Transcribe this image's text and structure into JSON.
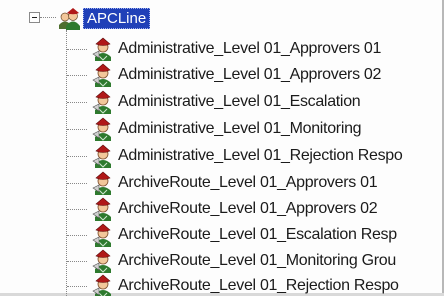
{
  "tree": {
    "root": {
      "label": "APCLine",
      "icon": "user-group-icon",
      "expanded": true,
      "selected": true
    },
    "children": [
      {
        "label": "Administrative_Level 01_Approvers 01",
        "icon": "user-role-icon"
      },
      {
        "label": "Administrative_Level 01_Approvers 02",
        "icon": "user-role-icon"
      },
      {
        "label": "Administrative_Level 01_Escalation",
        "icon": "user-role-icon"
      },
      {
        "label": "Administrative_Level 01_Monitoring",
        "icon": "user-role-icon"
      },
      {
        "label": "Administrative_Level 01_Rejection Respo",
        "icon": "user-role-icon"
      },
      {
        "label": "ArchiveRoute_Level 01_Approvers 01",
        "icon": "user-role-icon"
      },
      {
        "label": "ArchiveRoute_Level 01_Approvers 02",
        "icon": "user-role-icon"
      },
      {
        "label": "ArchiveRoute_Level 01_Escalation Resp",
        "icon": "user-role-icon"
      },
      {
        "label": "ArchiveRoute_Level 01_Monitoring Grou",
        "icon": "user-role-icon"
      },
      {
        "label": "ArchiveRoute_Level 01_Rejection Respo",
        "icon": "user-role-icon"
      }
    ]
  },
  "colors": {
    "selection": "#2040b8",
    "icon_hat": "#b01818",
    "icon_body": "#2e7a2e",
    "icon_face": "#f2c79a"
  }
}
